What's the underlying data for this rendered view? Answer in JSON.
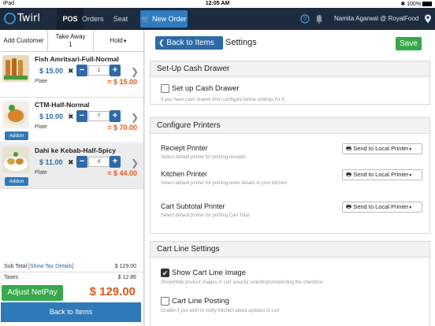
{
  "status": {
    "carrier": "iPad",
    "time": "12:05 AM",
    "battery": "100%"
  },
  "nav": {
    "brand": "Twirl",
    "tabs": [
      "POS",
      "Orders",
      "Seat"
    ],
    "new_order": "New Order",
    "user": "Namita Agarwal @ RoyalFood"
  },
  "cart": {
    "actions": {
      "add_customer": "Add Customer",
      "take_away": "Take Away",
      "take_away_count": "1",
      "hold": "Hold"
    },
    "items": [
      {
        "name": "Fish Amritsari-Full-Normal",
        "price": "$ 15.00",
        "qty": "1",
        "unit": "Plate",
        "total": "= $ 15.00",
        "addon": ""
      },
      {
        "name": "CTM-Half-Normal",
        "price": "$ 10.00",
        "qty": "7",
        "unit": "Plate",
        "total": "= $ 70.00",
        "addon": "Addon"
      },
      {
        "name": "Dahi ke Kebab-Half-Spicy",
        "price": "$ 11.00",
        "qty": "4",
        "unit": "Plate",
        "total": "= $ 44.00",
        "addon": "Addon"
      }
    ],
    "multiply": "✖",
    "subtotal_label": "Sub Total",
    "tax_details_link": "[Show Tax Details]",
    "subtotal": "$ 129.00",
    "taxes_label": "Taxes",
    "taxes": "$ 12.86",
    "adjust_label": "Adjust NetPay",
    "grand_total": "$ 129.00",
    "back_label": "Back to Items"
  },
  "settings": {
    "back_label": "Back to Items",
    "title": "Settings",
    "save_label": "Save",
    "cash_drawer": {
      "header": "Set-Up Cash Drawer",
      "label": "Set up Cash Drawer",
      "desc": "If you have cash drawer then configure below settings for it.",
      "checked": false
    },
    "printers": {
      "header": "Configure Printers",
      "rows": [
        {
          "label": "Reciept Printer",
          "desc": "Select default printer for printing receipts",
          "button": "Send to Local Printer"
        },
        {
          "label": "Kitchen Printer",
          "desc": "Select default printer for printing order details in your kitchen",
          "button": "Send to Local Printer"
        },
        {
          "label": "Cart Subtotal Printer",
          "desc": "Select default printer for printing Cart Total",
          "button": "Send to Local Printer"
        }
      ]
    },
    "cart_line": {
      "header": "Cart Line Settings",
      "rows": [
        {
          "label": "Show Cart Line Image",
          "desc": "Show/Hide product images in cart area by selecting/unselecting the checkbox",
          "checked": true
        },
        {
          "label": "Cart Line Posting",
          "desc": "Enable if you wish to notify Kitchen about updates in cart",
          "checked": false
        }
      ]
    }
  },
  "colors": {
    "nav_bg": "#1c2b3d",
    "primary": "#2e6aa8",
    "success": "#36a94a",
    "price_total": "#e2561b"
  }
}
